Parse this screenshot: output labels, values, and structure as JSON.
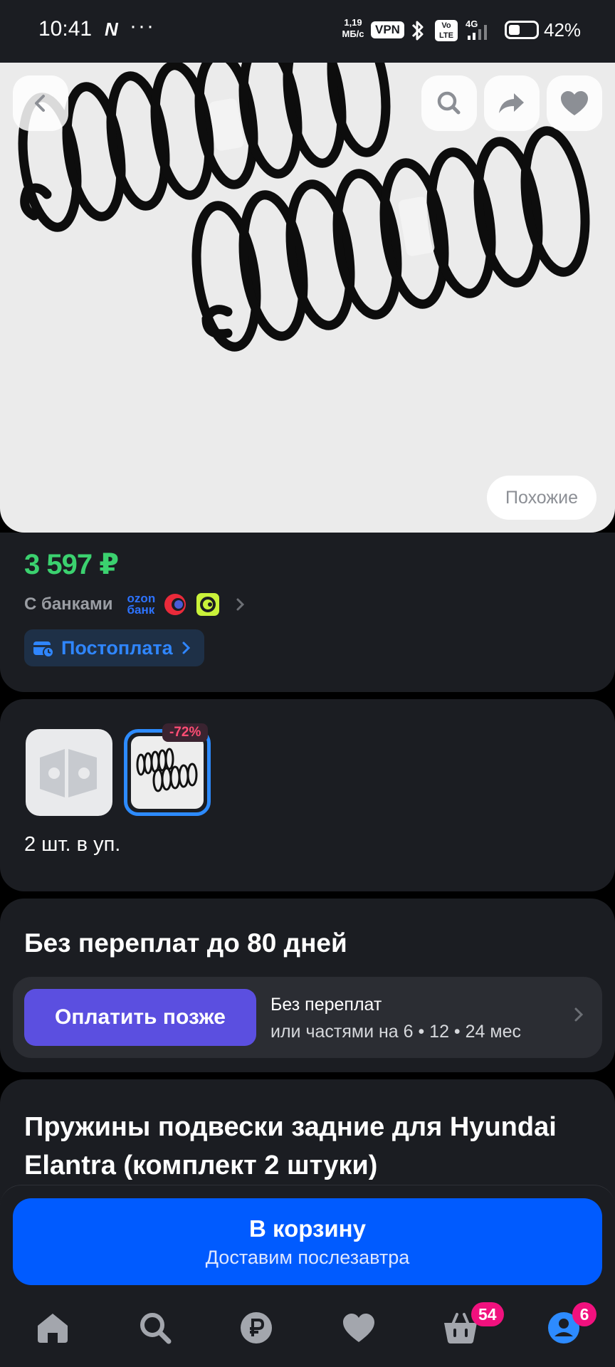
{
  "status_bar": {
    "time": "10:41",
    "nfc_glyph": "N",
    "more_dots": "···",
    "speed_value": "1,19",
    "speed_unit": "МБ/с",
    "vpn": "VPN",
    "volte_top": "Vo",
    "volte_bottom": "LTE",
    "network": "4G",
    "battery_percent": "42%",
    "battery_level": 0.42
  },
  "hero": {
    "similar_label": "Похожие",
    "icons": {
      "back": "chevron-left-icon",
      "search": "search-icon",
      "share": "share-icon",
      "favorite": "heart-icon"
    }
  },
  "pricing": {
    "price": "3 597 ₽",
    "banks_label": "С банками",
    "ozon_bank_line1": "ozon",
    "ozon_bank_line2": "банк",
    "postpay_label": "Постоплата"
  },
  "variants": {
    "discount": "-72%",
    "pack_text": "2 шт. в уп."
  },
  "installments": {
    "title": "Без переплат до 80 дней",
    "button_label": "Оплатить позже",
    "line1": "Без переплат",
    "line2": "или частями на 6 • 12 • 24 мес"
  },
  "product": {
    "title": "Пружины подвески задние для Hyundai Elantra (комплект 2 штуки)"
  },
  "cart": {
    "button_label": "В корзину",
    "delivery_label": "Доставим послезавтра"
  },
  "tabbar": {
    "cart_badge": "54",
    "profile_badge": "6"
  },
  "colors": {
    "background": "#000000",
    "card": "#1b1d22",
    "price_green": "#3bd16f",
    "accent_blue": "#005bff",
    "pay_later_purple": "#5b4fe0",
    "badge_pink": "#f1117e"
  }
}
